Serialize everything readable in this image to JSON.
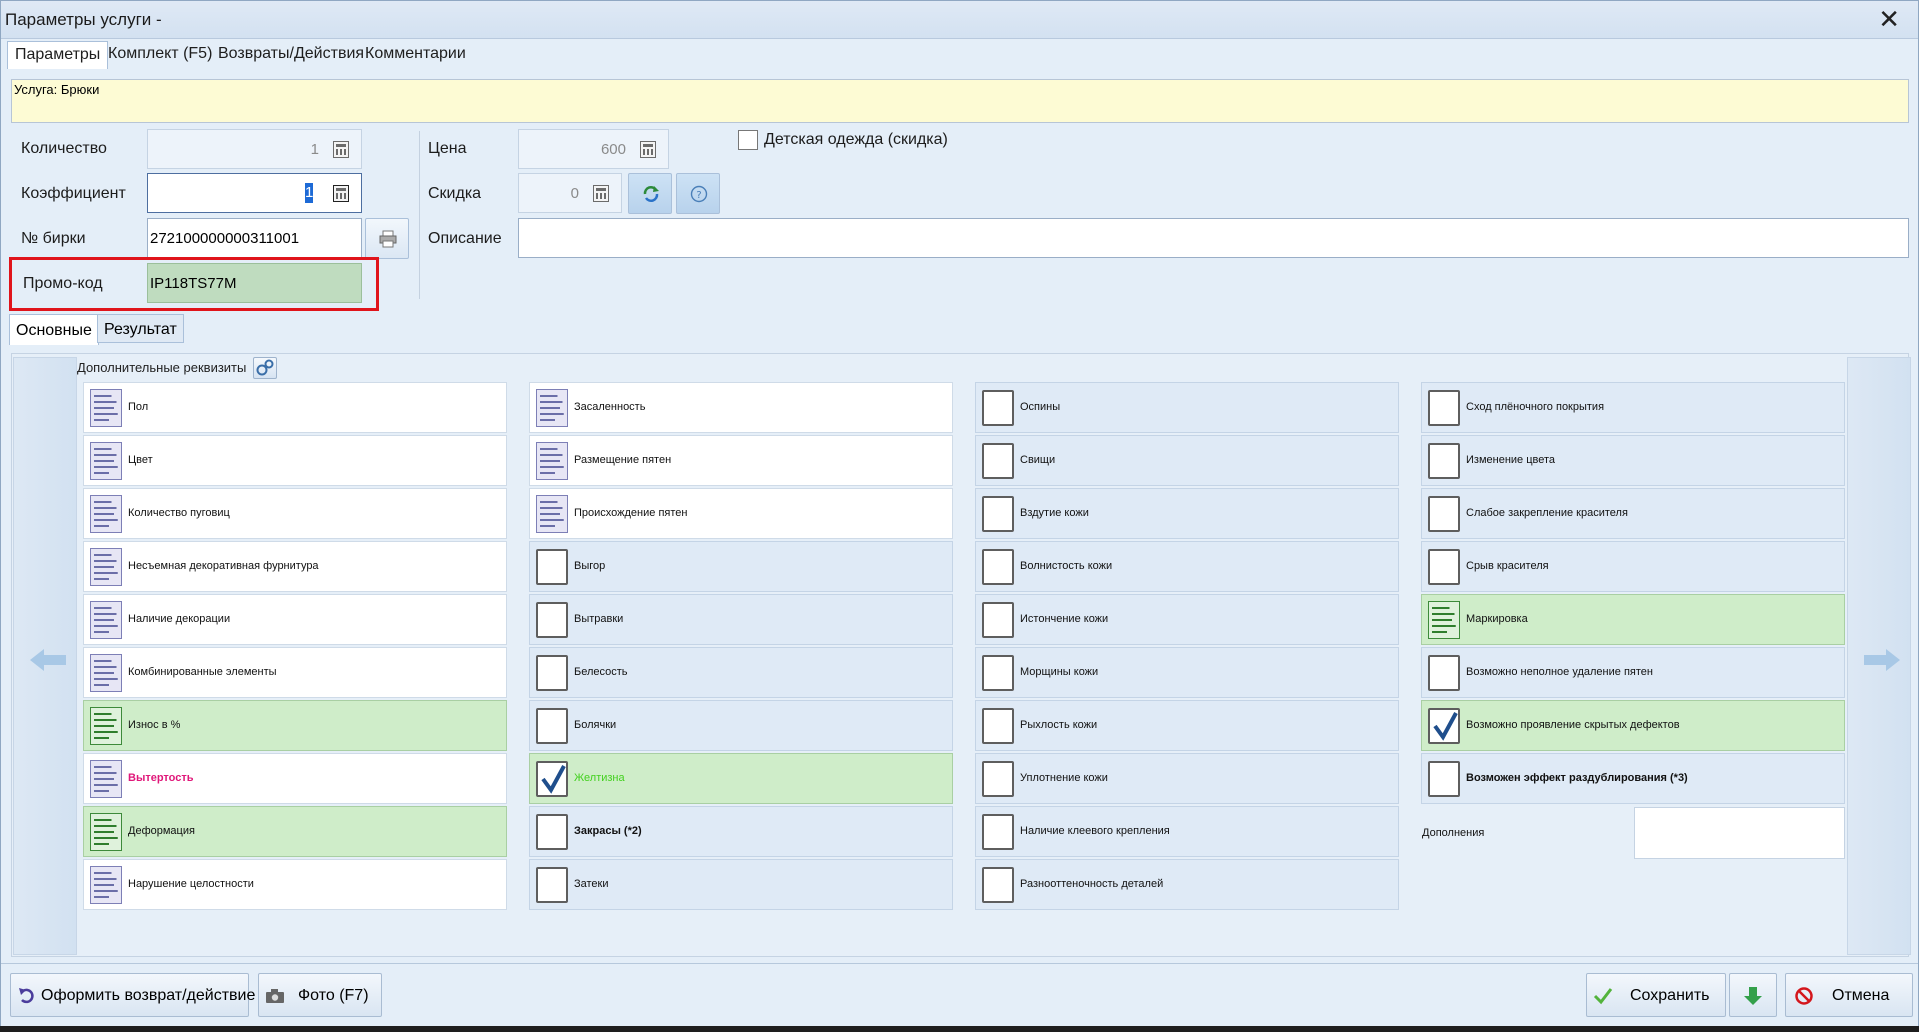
{
  "window": {
    "title": "Параметры услуги -",
    "close_glyph": "✕"
  },
  "tabs": [
    "Параметры",
    "Комплект (F5)",
    "Возвраты/Действия",
    "Комментарии"
  ],
  "service_banner": "Услуга: Брюки",
  "form": {
    "quantity_label": "Количество",
    "quantity_value": "1",
    "coefficient_label": "Коэффициент",
    "coefficient_value": "1",
    "tag_label": "№ бирки",
    "tag_value": "272100000000311001",
    "promo_label": "Промо-код",
    "promo_value": "IP118TS77M",
    "price_label": "Цена",
    "price_value": "600",
    "discount_label": "Скидка",
    "discount_value": "0",
    "description_label": "Описание",
    "description_value": "",
    "child_clothes_label": "Детская одежда (скидка)",
    "child_clothes_checked": false
  },
  "sub_tabs": [
    "Основные",
    "Результат"
  ],
  "extra_header": "Дополнительные реквизиты",
  "columns": [
    [
      {
        "label": "Пол",
        "icon": "list-icon",
        "style": "white"
      },
      {
        "label": "Цвет",
        "icon": "list-icon",
        "style": "white"
      },
      {
        "label": "Количество пуговиц",
        "icon": "list-icon",
        "style": "white"
      },
      {
        "label": "Несъемная декоративная фурнитура",
        "icon": "list-icon",
        "style": "white"
      },
      {
        "label": "Наличие декорации",
        "icon": "list-icon",
        "style": "white"
      },
      {
        "label": "Комбинированные элементы",
        "icon": "list-icon",
        "style": "white"
      },
      {
        "label": "Износ в %",
        "icon": "list-icon-green",
        "style": "green"
      },
      {
        "label": "Вытертость",
        "icon": "list-icon",
        "style": "white",
        "text": "pink"
      },
      {
        "label": "Деформация",
        "icon": "list-icon-green",
        "style": "green"
      },
      {
        "label": "Нарушение целостности",
        "icon": "list-icon",
        "style": "white"
      }
    ],
    [
      {
        "label": "Засаленность",
        "icon": "list-icon",
        "style": "white"
      },
      {
        "label": "Размещение пятен",
        "icon": "list-icon",
        "style": "white"
      },
      {
        "label": "Происхождение пятен",
        "icon": "list-icon",
        "style": "white"
      },
      {
        "label": "Выгор",
        "icon": "checkbox-icon",
        "style": "blue"
      },
      {
        "label": "Вытравки",
        "icon": "checkbox-icon",
        "style": "blue"
      },
      {
        "label": "Белесость",
        "icon": "checkbox-icon",
        "style": "blue"
      },
      {
        "label": "Болячки",
        "icon": "checkbox-icon",
        "style": "blue"
      },
      {
        "label": "Желтизна",
        "icon": "checkbox-checked-icon",
        "style": "green",
        "text": "lime"
      },
      {
        "label": "Закрасы (*2)",
        "icon": "checkbox-icon",
        "style": "blue",
        "text": "bold"
      },
      {
        "label": "Затеки",
        "icon": "checkbox-icon",
        "style": "blue"
      }
    ],
    [
      {
        "label": "Оспины",
        "icon": "checkbox-icon",
        "style": "blue"
      },
      {
        "label": "Свищи",
        "icon": "checkbox-icon",
        "style": "blue"
      },
      {
        "label": "Вздутие кожи",
        "icon": "checkbox-icon",
        "style": "blue"
      },
      {
        "label": "Волнистость кожи",
        "icon": "checkbox-icon",
        "style": "blue"
      },
      {
        "label": "Истончение кожи",
        "icon": "checkbox-icon",
        "style": "blue"
      },
      {
        "label": "Морщины кожи",
        "icon": "checkbox-icon",
        "style": "blue"
      },
      {
        "label": "Рыхлость кожи",
        "icon": "checkbox-icon",
        "style": "blue"
      },
      {
        "label": "Уплотнение кожи",
        "icon": "checkbox-icon",
        "style": "blue"
      },
      {
        "label": "Наличие клеевого крепления",
        "icon": "checkbox-icon",
        "style": "blue"
      },
      {
        "label": "Разнооттеночность деталей",
        "icon": "checkbox-icon",
        "style": "blue"
      }
    ],
    [
      {
        "label": "Сход плёночного покрытия",
        "icon": "checkbox-icon",
        "style": "blue"
      },
      {
        "label": "Изменение цвета",
        "icon": "checkbox-icon",
        "style": "blue"
      },
      {
        "label": "Слабое закрепление красителя",
        "icon": "checkbox-icon",
        "style": "blue"
      },
      {
        "label": "Срыв красителя",
        "icon": "checkbox-icon",
        "style": "blue"
      },
      {
        "label": "Маркировка",
        "icon": "list-icon-green",
        "style": "green"
      },
      {
        "label": "Возможно неполное удаление пятен",
        "icon": "checkbox-icon",
        "style": "blue"
      },
      {
        "label": "Возможно проявление скрытых дефектов",
        "icon": "checkbox-checked-icon",
        "style": "green"
      },
      {
        "label": "Возможен эффект раздублирования (*3)",
        "icon": "checkbox-icon",
        "style": "blue",
        "text": "bold"
      }
    ]
  ],
  "extras_label": "Дополнения",
  "footer": {
    "return_button": "Оформить возврат/действие",
    "photo_button": "Фото (F7)",
    "save_button": "Сохранить",
    "cancel_button": "Отмена"
  },
  "colors": {
    "window_bg": "#e4eef8",
    "highlight_green": "#cfedc9",
    "promo_green": "#bfdcbf",
    "annotation_red": "#e0141b",
    "warning_pink": "#e0187a",
    "checked_lime": "#43d11f"
  }
}
